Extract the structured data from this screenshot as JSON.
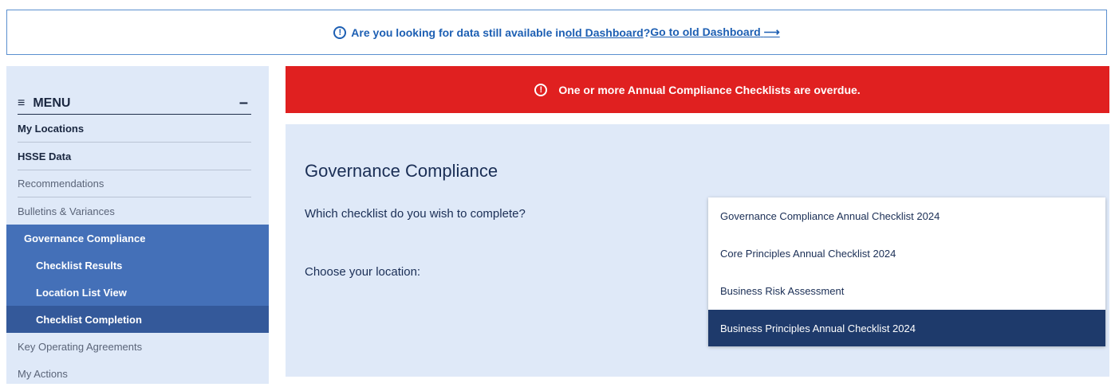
{
  "banner": {
    "text_before": "Are you looking for data still available in ",
    "link_old": "old Dashboard",
    "text_mid": "? ",
    "link_go": "Go to old Dashboard",
    "arrow": "⟶"
  },
  "menu": {
    "title": "MENU",
    "items": [
      {
        "label": "My Locations"
      },
      {
        "label": "HSSE Data"
      },
      {
        "label": "Recommendations"
      },
      {
        "label": "Bulletins & Variances"
      },
      {
        "label": "Governance Compliance"
      },
      {
        "label": "Checklist Results"
      },
      {
        "label": "Location List View"
      },
      {
        "label": "Checklist Completion"
      },
      {
        "label": "Key Operating Agreements"
      },
      {
        "label": "My Actions"
      }
    ]
  },
  "alert": {
    "message": "One or more Annual Compliance Checklists are overdue."
  },
  "main": {
    "title": "Governance Compliance",
    "question": "Which checklist do you wish to complete?",
    "location_label": "Choose your location:"
  },
  "checklist_dropdown": {
    "options": [
      "Governance Compliance Annual Checklist 2024",
      "Core Principles Annual Checklist 2024",
      "Business Risk Assessment",
      "Business Principles Annual Checklist 2024"
    ],
    "highlighted": "Business Principles Annual Checklist 2024"
  },
  "colors": {
    "accent_blue": "#1d5fb3",
    "alert_red": "#e02020",
    "menu_active": "#4470b8",
    "menu_current": "#34599a",
    "dropdown_selected": "#1e3a6b",
    "panel_bg": "#dfe9f8"
  }
}
